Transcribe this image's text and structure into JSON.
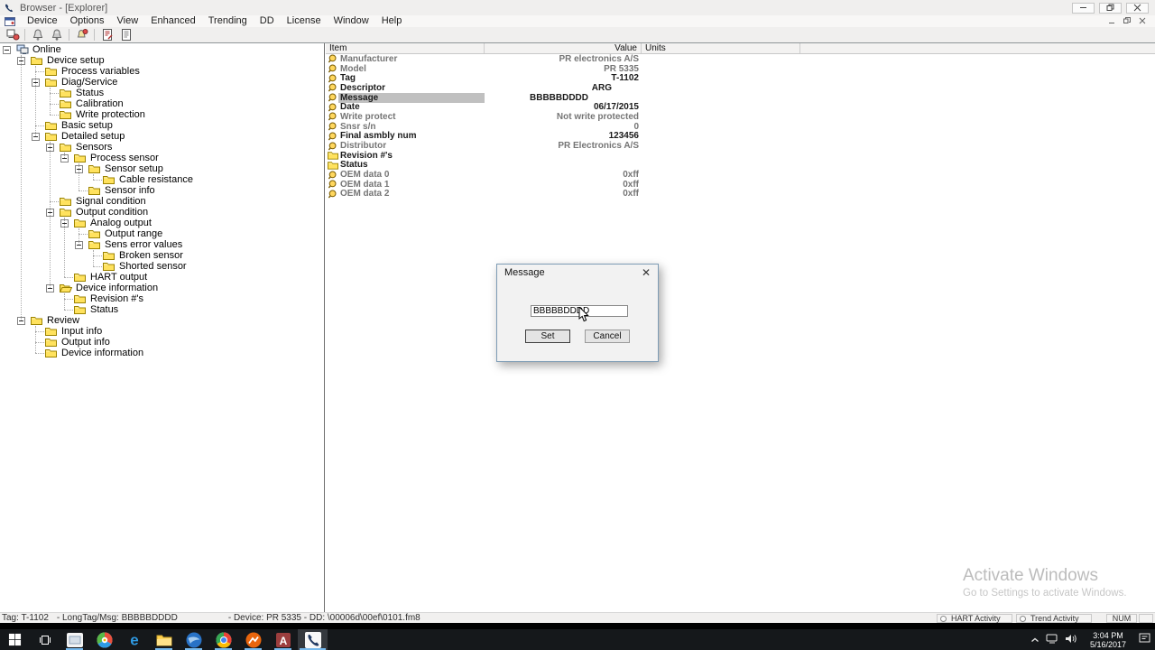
{
  "window": {
    "title": "Browser - [Explorer]"
  },
  "menu": {
    "items": [
      "Device",
      "Options",
      "View",
      "Enhanced",
      "Trending",
      "DD",
      "License",
      "Window",
      "Help"
    ]
  },
  "toolbar": {
    "groups": [
      [
        "device-connect-icon"
      ],
      [
        "download-device-icon",
        "upload-device-icon"
      ],
      [
        "alarm-icon"
      ],
      [
        "edit-document-icon",
        "document-icon"
      ]
    ]
  },
  "tree": {
    "items": [
      {
        "label": "Online",
        "level": 0,
        "expander": true,
        "icon": "online"
      },
      {
        "label": "Device setup",
        "level": 1,
        "expander": true,
        "icon": "folder"
      },
      {
        "label": "Process variables",
        "level": 2,
        "expander": false,
        "icon": "folder"
      },
      {
        "label": "Diag/Service",
        "level": 2,
        "expander": true,
        "icon": "folder"
      },
      {
        "label": "Status",
        "level": 3,
        "expander": false,
        "icon": "folder"
      },
      {
        "label": "Calibration",
        "level": 3,
        "expander": false,
        "icon": "folder"
      },
      {
        "label": "Write protection",
        "level": 3,
        "expander": false,
        "icon": "folder"
      },
      {
        "label": "Basic setup",
        "level": 2,
        "expander": false,
        "icon": "folder"
      },
      {
        "label": "Detailed setup",
        "level": 2,
        "expander": true,
        "icon": "folder"
      },
      {
        "label": "Sensors",
        "level": 3,
        "expander": true,
        "icon": "folder"
      },
      {
        "label": "Process sensor",
        "level": 4,
        "expander": true,
        "icon": "folder"
      },
      {
        "label": "Sensor setup",
        "level": 5,
        "expander": true,
        "icon": "folder"
      },
      {
        "label": "Cable resistance",
        "level": 6,
        "expander": false,
        "icon": "folder"
      },
      {
        "label": "Sensor info",
        "level": 5,
        "expander": false,
        "icon": "folder"
      },
      {
        "label": "Signal condition",
        "level": 3,
        "expander": false,
        "icon": "folder"
      },
      {
        "label": "Output condition",
        "level": 3,
        "expander": true,
        "icon": "folder"
      },
      {
        "label": "Analog output",
        "level": 4,
        "expander": true,
        "icon": "folder"
      },
      {
        "label": "Output range",
        "level": 5,
        "expander": false,
        "icon": "folder"
      },
      {
        "label": "Sens error values",
        "level": 5,
        "expander": true,
        "icon": "folder"
      },
      {
        "label": "Broken sensor",
        "level": 6,
        "expander": false,
        "icon": "folder"
      },
      {
        "label": "Shorted sensor",
        "level": 6,
        "expander": false,
        "icon": "folder"
      },
      {
        "label": "HART output",
        "level": 4,
        "expander": false,
        "icon": "folder"
      },
      {
        "label": "Device information",
        "level": 3,
        "expander": true,
        "icon": "folder-open"
      },
      {
        "label": "Revision #'s",
        "level": 4,
        "expander": false,
        "icon": "folder"
      },
      {
        "label": "Status",
        "level": 4,
        "expander": false,
        "icon": "folder"
      },
      {
        "label": "Review",
        "level": 1,
        "expander": true,
        "icon": "folder"
      },
      {
        "label": "Input info",
        "level": 2,
        "expander": false,
        "icon": "folder"
      },
      {
        "label": "Output info",
        "level": 2,
        "expander": false,
        "icon": "folder"
      },
      {
        "label": "Device information",
        "level": 2,
        "expander": false,
        "icon": "folder"
      }
    ]
  },
  "grid": {
    "columns": [
      "Item",
      "Value",
      "Units"
    ],
    "rows": [
      {
        "icon": "tag",
        "label": "Manufacturer",
        "value": "PR electronics A/S",
        "dim": true
      },
      {
        "icon": "tag",
        "label": "Model",
        "value": "PR 5335",
        "dim": true
      },
      {
        "icon": "tag",
        "label": "Tag",
        "value": "T-1102",
        "dim": false
      },
      {
        "icon": "tag",
        "label": "Descriptor",
        "value": "ARG",
        "dim": false,
        "value_shift": 30
      },
      {
        "icon": "tag",
        "label": "Message",
        "value": "BBBBBDDDD",
        "dim": false,
        "selected": true,
        "value_shift": 56
      },
      {
        "icon": "tag",
        "label": "Date",
        "value": "06/17/2015",
        "dim": false
      },
      {
        "icon": "tag",
        "label": "Write protect",
        "value": "Not write protected",
        "dim": true
      },
      {
        "icon": "tag",
        "label": "Snsr s/n",
        "value": "0",
        "dim": true
      },
      {
        "icon": "tag",
        "label": "Final asmbly num",
        "value": "123456",
        "dim": false
      },
      {
        "icon": "tag",
        "label": "Distributor",
        "value": "PR Electronics A/S",
        "dim": true
      },
      {
        "icon": "folder",
        "label": "Revision #'s",
        "value": "",
        "dim": false
      },
      {
        "icon": "folder",
        "label": "Status",
        "value": "",
        "dim": false
      },
      {
        "icon": "tag",
        "label": "OEM data 0",
        "value": "0xff",
        "dim": true
      },
      {
        "icon": "tag",
        "label": "OEM data 1",
        "value": "0xff",
        "dim": true
      },
      {
        "icon": "tag",
        "label": "OEM data 2",
        "value": "0xff",
        "dim": true
      }
    ]
  },
  "dialog": {
    "title": "Message",
    "input_value": "BBBBBDDDD",
    "set_label": "Set",
    "cancel_label": "Cancel"
  },
  "statusbar": {
    "tag": "Tag: T-1102",
    "longtag": "- LongTag/Msg: BBBBBDDDD",
    "device": "- Device: PR 5335 - DD: \\00006d\\00ef\\0101.fm8",
    "panels": [
      "HART Activity",
      "Trend Activity",
      "NUM"
    ]
  },
  "taskbar": {
    "icons": [
      {
        "name": "start-button",
        "icon": "start"
      },
      {
        "name": "task-view-button",
        "icon": "task-view"
      },
      {
        "name": "frame-app-button",
        "icon": "frame-app",
        "running": true
      },
      {
        "name": "paint-app-button",
        "icon": "paint"
      },
      {
        "name": "edge-browser-button",
        "icon": "edge"
      },
      {
        "name": "file-explorer-button",
        "icon": "explorer",
        "running": true
      },
      {
        "name": "thunderbird-button",
        "icon": "thunderbird",
        "running": true
      },
      {
        "name": "chrome-button",
        "icon": "chrome",
        "running": true
      },
      {
        "name": "orange-app-button",
        "icon": "orange-app",
        "running": true
      },
      {
        "name": "access-button",
        "icon": "access",
        "running": true
      },
      {
        "name": "hart-browser-button",
        "icon": "hart-app",
        "running": true,
        "active": true
      }
    ],
    "clock": {
      "time": "3:04 PM",
      "date": "5/16/2017"
    }
  },
  "watermark": {
    "line1": "Activate Windows",
    "line2": "Go to Settings to activate Windows."
  },
  "colors": {
    "accent": "#76b9ed",
    "selection": "#c0c0c0",
    "folder": "#ffe25e"
  }
}
